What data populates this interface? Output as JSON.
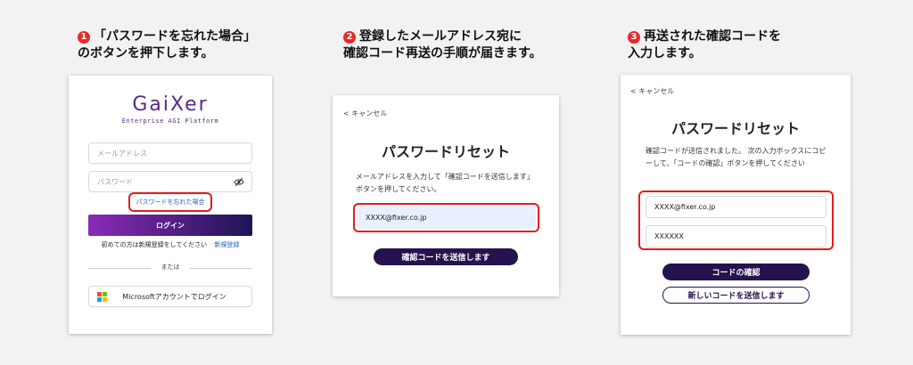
{
  "steps": [
    {
      "num": "1",
      "line1": "「パスワードを忘れた場合」",
      "line2": "のボタンを押下します。"
    },
    {
      "num": "2",
      "line1": "登録したメールアドレス宛に",
      "line2": "確認コード再送の手順が届きます。"
    },
    {
      "num": "3",
      "line1": "再送された確認コードを",
      "line2": "入力します。"
    }
  ],
  "login": {
    "logo": "GaiXer",
    "tagline": "Enterprise AGI Platform",
    "email_placeholder": "メールアドレス",
    "password_placeholder": "パスワード",
    "forgot_link": "パスワードを忘れた場合",
    "login_button": "ログイン",
    "register_text": "初めての方は新規登録をしてください",
    "register_link": "新規登録",
    "or_text": "または",
    "ms_button": "Microsoftアカウントでログイン"
  },
  "reset": {
    "cancel": "キャンセル",
    "title": "パスワードリセット",
    "description": "メールアドレスを入力して「確認コードを送信します」ボタンを押してください。",
    "email_value": "XXXX@fixer.co.jp",
    "send_button": "確認コードを送信します"
  },
  "verify": {
    "cancel": "キャンセル",
    "title": "パスワードリセット",
    "description": "確認コードが送信されました。 次の入力ボックスにコピーして、「コードの確認」ボタンを押してください",
    "email_value": "XXXX@fixer.co.jp",
    "code_value": "XXXXXX",
    "confirm_button": "コードの確認",
    "resend_button": "新しいコードを送信します"
  },
  "colors": {
    "accent_red": "#e81b1b",
    "brand_purple": "#26124d",
    "link_blue": "#1f5fd1"
  }
}
